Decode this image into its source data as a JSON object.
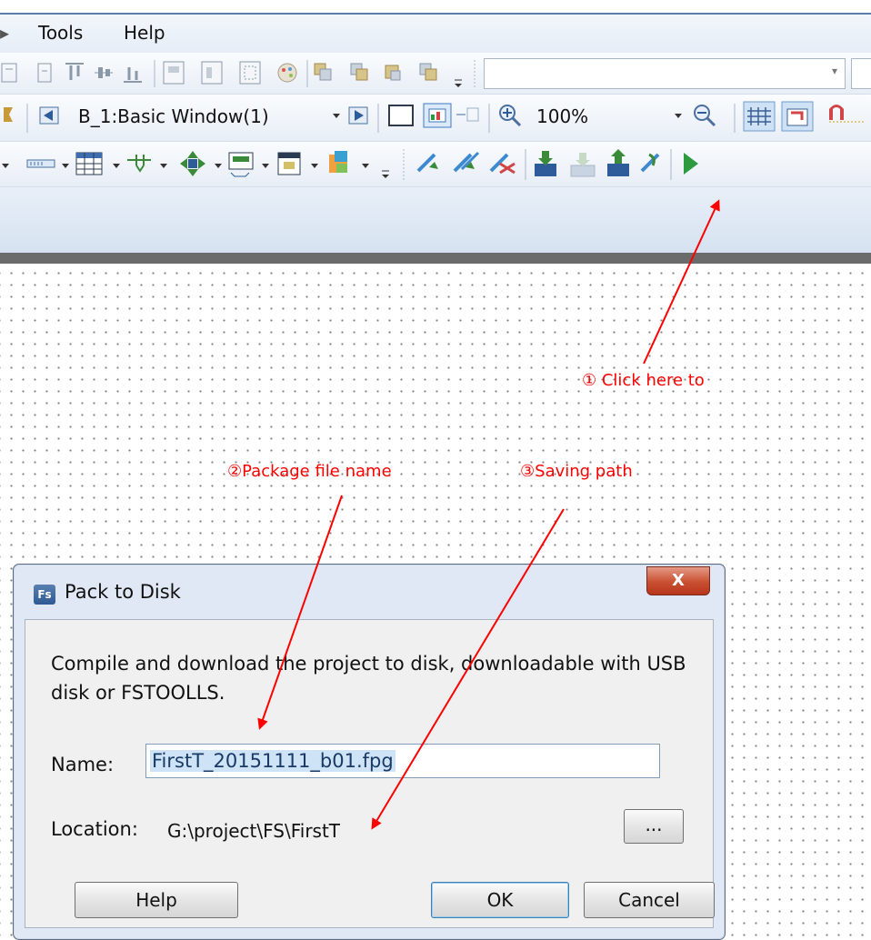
{
  "menubar": {
    "items": [
      "Tools",
      "Help"
    ]
  },
  "toolbar2": {
    "window_select": "B_1:Basic Window(1)",
    "zoom": "100%"
  },
  "icons": {
    "tb1": [
      "align-left-icon",
      "align-right-icon",
      "align-top-icon",
      "align-center-icon",
      "align-bottom-icon",
      "group-icon",
      "ungroup-icon",
      "grid-fit-icon",
      "palette-icon",
      "copy-icon",
      "front-icon",
      "back-icon",
      "paste-icon"
    ],
    "tb3": [
      "bitmap-icon",
      "table-icon",
      "component-icon",
      "move-icon",
      "display-icon",
      "calendar-icon",
      "layer-icon",
      "compile-icon",
      "compile-all-icon",
      "clear-icon",
      "download-icon",
      "pack-to-disk-icon",
      "upload-icon",
      "tools-icon",
      "run-icon"
    ]
  },
  "annotations": {
    "step1": "① Click   here   to",
    "step2": "②Package file name",
    "step3": "③Saving path"
  },
  "dialog": {
    "title": "Pack to Disk",
    "logo": "Fs",
    "close": "X",
    "description": "Compile and download the project to disk, downloadable with USB disk or FSTOOLLS.",
    "name_label": "Name:",
    "name_value": "FirstT_20151111_b01.fpg",
    "location_label": "Location:",
    "location_value": "G:\\project\\FS\\FirstT",
    "browse": "...",
    "help": "Help",
    "ok": "OK",
    "cancel": "Cancel"
  },
  "colors": {
    "annotation": "#ff0000",
    "accent": "#3c7fb1"
  }
}
